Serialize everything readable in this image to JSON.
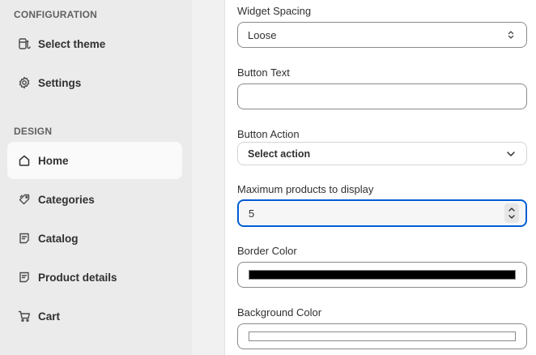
{
  "sidebar": {
    "configuration_label": "CONFIGURATION",
    "configuration_items": [
      {
        "label": "Select theme",
        "icon": "theme-icon"
      },
      {
        "label": "Settings",
        "icon": "gear-icon"
      }
    ],
    "design_label": "DESIGN",
    "design_items": [
      {
        "label": "Home",
        "icon": "home-icon",
        "active": true
      },
      {
        "label": "Categories",
        "icon": "tag-icon"
      },
      {
        "label": "Catalog",
        "icon": "catalog-icon"
      },
      {
        "label": "Product details",
        "icon": "product-icon"
      },
      {
        "label": "Cart",
        "icon": "cart-icon"
      }
    ]
  },
  "panel": {
    "widget_spacing": {
      "label": "Widget Spacing",
      "value": "Loose"
    },
    "button_text": {
      "label": "Button Text",
      "value": ""
    },
    "button_action": {
      "label": "Button Action",
      "value": "Select action"
    },
    "max_products": {
      "label": "Maximum products to display",
      "value": "5"
    },
    "border_color": {
      "label": "Border Color",
      "color": "#000000"
    },
    "background_color": {
      "label": "Background Color",
      "color": "#ffffff"
    }
  },
  "colors": {
    "focus_ring": "#005bd3",
    "sidebar_bg": "#ebebeb",
    "active_item_bg": "#fafafa"
  }
}
